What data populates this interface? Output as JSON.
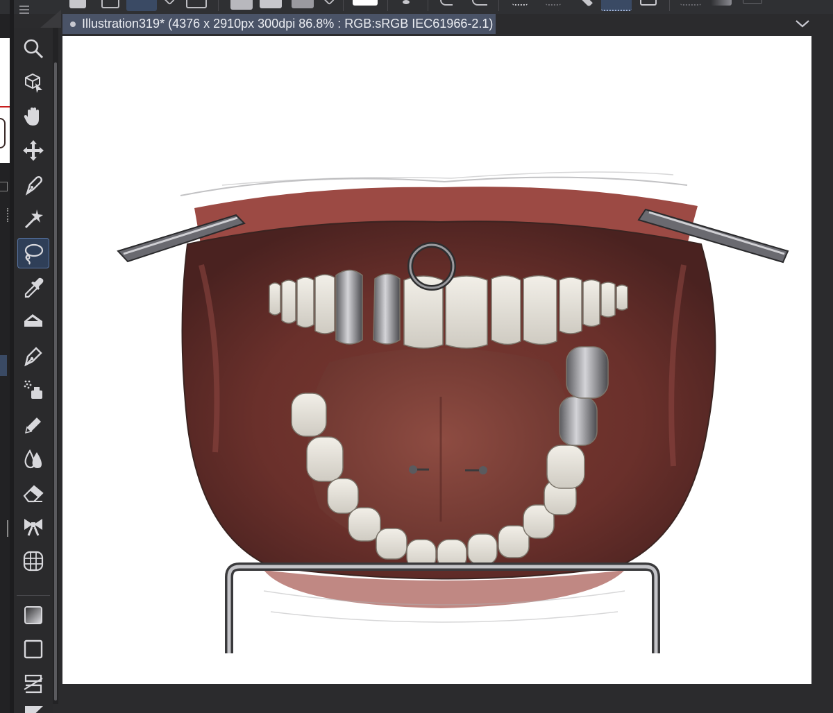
{
  "app": {
    "document_tab": {
      "title": "Illustration319* (4376 x 2910px 300dpi 86.8% : RGB:sRGB IEC61966-2.1)"
    }
  },
  "toolbar": {
    "icons": [
      "menu-icon",
      "new-icon",
      "open-icon",
      "save-icon",
      "dropdown-icon",
      "frame-icon",
      "add-layer-icon",
      "fill-icon",
      "dropdown-icon",
      "white-swatch",
      "burst-icon",
      "ruler-icon",
      "selection-icon",
      "transform-icon"
    ]
  },
  "tools": [
    {
      "name": "zoom",
      "icon": "magnifier-icon"
    },
    {
      "name": "operation",
      "icon": "object-cursor-icon"
    },
    {
      "name": "move",
      "icon": "hand-icon"
    },
    {
      "name": "move-layer",
      "icon": "move-arrows-icon"
    },
    {
      "name": "pen",
      "icon": "pen-nib-icon"
    },
    {
      "name": "auto-select",
      "icon": "magic-wand-icon"
    },
    {
      "name": "lasso",
      "icon": "lasso-icon",
      "active": true
    },
    {
      "name": "eyedropper",
      "icon": "eyedropper-icon"
    },
    {
      "name": "fill",
      "icon": "paint-bucket-icon"
    },
    {
      "name": "pen-alt",
      "icon": "fountain-pen-icon"
    },
    {
      "name": "airbrush",
      "icon": "airbrush-icon"
    },
    {
      "name": "decoration",
      "icon": "marker-icon"
    },
    {
      "name": "blend",
      "icon": "blend-drops-icon"
    },
    {
      "name": "eraser",
      "icon": "eraser-icon"
    },
    {
      "name": "gradient-mesh",
      "icon": "bow-icon"
    },
    {
      "name": "figure",
      "icon": "mesh-globe-icon"
    },
    {
      "name": "gradient",
      "icon": "gradient-square-icon"
    },
    {
      "name": "shape",
      "icon": "rectangle-icon"
    },
    {
      "name": "ruler",
      "icon": "perspective-ruler-icon"
    }
  ],
  "colors": {
    "canvas_bg": "#ffffff",
    "tab_bg": "#4a5367",
    "active_tool_bg": "#2f3f58"
  }
}
